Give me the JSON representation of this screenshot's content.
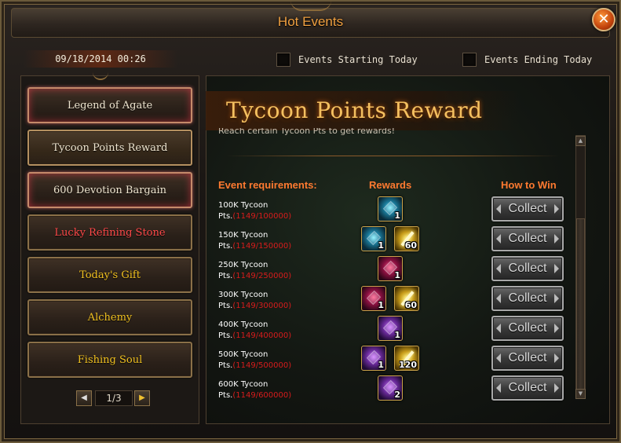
{
  "window": {
    "title": "Hot Events",
    "close_glyph": "✕"
  },
  "header": {
    "datetime": "09/18/2014 00:26",
    "filters": [
      {
        "label": "Events Starting Today",
        "checked": false
      },
      {
        "label": "Events Ending Today",
        "checked": false
      }
    ]
  },
  "sidebar": {
    "items": [
      {
        "label": "Legend of Agate",
        "color": "#f0e6d0"
      },
      {
        "label": "Tycoon Points Reward",
        "color": "#f0e6d0"
      },
      {
        "label": "600 Devotion Bargain",
        "color": "#f0e6d0"
      },
      {
        "label": "Lucky Refining Stone",
        "color": "#ff4a4a"
      },
      {
        "label": "Today's Gift",
        "color": "#f0c020"
      },
      {
        "label": "Alchemy",
        "color": "#f0c020"
      },
      {
        "label": "Fishing Soul",
        "color": "#f0c020"
      }
    ],
    "pager": {
      "prev_icon": "arrow-left-icon",
      "next_icon": "arrow-right-icon",
      "page": "1/3"
    }
  },
  "event": {
    "title": "Tycoon Points Reward",
    "subtitle": "Reach certain Tycoon Pts to get rewards!",
    "columns": {
      "requirements": "Event requirements:",
      "rewards": "Rewards",
      "how_to_win": "How to Win"
    },
    "rows": [
      {
        "name": "100K Tycoon",
        "pts_label": "Pts.",
        "progress": "(1149/100000)",
        "button": "Collect",
        "rewards": [
          {
            "icon": "cyan-gem-icon",
            "qty": "1"
          }
        ]
      },
      {
        "name": "150K Tycoon",
        "pts_label": "Pts.",
        "progress": "(1149/150000)",
        "button": "Collect",
        "rewards": [
          {
            "icon": "cyan-gem-icon",
            "qty": "1"
          },
          {
            "icon": "gold-stick-icon",
            "qty": "60"
          }
        ]
      },
      {
        "name": "250K Tycoon",
        "pts_label": "Pts.",
        "progress": "(1149/250000)",
        "button": "Collect",
        "rewards": [
          {
            "icon": "red-gem-icon",
            "qty": "1"
          }
        ]
      },
      {
        "name": "300K Tycoon",
        "pts_label": "Pts.",
        "progress": "(1149/300000)",
        "button": "Collect",
        "rewards": [
          {
            "icon": "red-gem-icon",
            "qty": "1"
          },
          {
            "icon": "gold-stick-icon",
            "qty": "60"
          }
        ]
      },
      {
        "name": "400K Tycoon",
        "pts_label": "Pts.",
        "progress": "(1149/400000)",
        "button": "Collect",
        "rewards": [
          {
            "icon": "purple-gem-icon",
            "qty": "1"
          }
        ]
      },
      {
        "name": "500K Tycoon",
        "pts_label": "Pts.",
        "progress": "(1149/500000)",
        "button": "Collect",
        "rewards": [
          {
            "icon": "purple-gem-icon",
            "qty": "1"
          },
          {
            "icon": "gold-stick-icon",
            "qty": "120"
          }
        ]
      },
      {
        "name": "600K Tycoon",
        "pts_label": "Pts.",
        "progress": "(1149/600000)",
        "button": "Collect",
        "rewards": [
          {
            "icon": "purple-gem-icon",
            "qty": "2"
          }
        ]
      }
    ]
  }
}
